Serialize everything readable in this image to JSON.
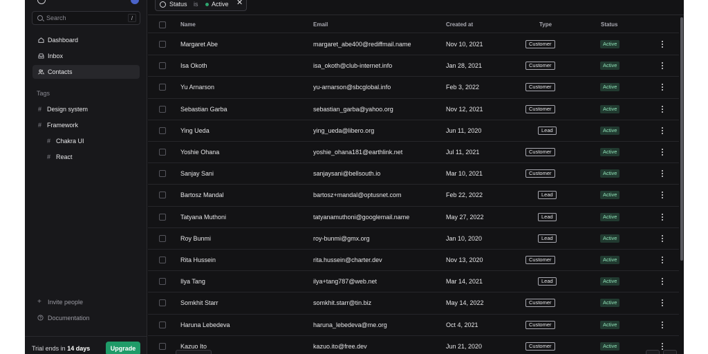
{
  "sidebar": {
    "search": {
      "placeholder": "Search",
      "shortcut": "/"
    },
    "nav": [
      {
        "label": "Dashboard",
        "icon": "home-icon",
        "active": false
      },
      {
        "label": "Inbox",
        "icon": "inbox-icon",
        "active": false
      },
      {
        "label": "Contacts",
        "icon": "users-icon",
        "active": true
      }
    ],
    "tags_heading": "Tags",
    "tags": [
      {
        "label": "Design system",
        "level": 0
      },
      {
        "label": "Framework",
        "level": 0
      },
      {
        "label": "Chakra UI",
        "level": 1
      },
      {
        "label": "React",
        "level": 1
      }
    ],
    "footer_links": [
      {
        "label": "Invite people",
        "icon": "plus-icon"
      },
      {
        "label": "Documentation",
        "icon": "help-circle-icon"
      }
    ],
    "trial": {
      "prefix": "Trial ends in ",
      "days": "14 days"
    },
    "upgrade_label": "Upgrade"
  },
  "filter": {
    "field": "Status",
    "operator": "is",
    "value": "Active"
  },
  "table": {
    "columns": {
      "name": "Name",
      "email": "Email",
      "created": "Created at",
      "type": "Type",
      "status": "Status"
    },
    "rows": [
      {
        "name": "Margaret Abe",
        "email": "margaret_abe400@rediffmail.name",
        "created": "Nov 10, 2021",
        "type": "Customer",
        "status": "Active"
      },
      {
        "name": "Isa Okoth",
        "email": "isa_okoth@club-internet.info",
        "created": "Jan 28, 2021",
        "type": "Customer",
        "status": "Active"
      },
      {
        "name": "Yu Arnarson",
        "email": "yu-arnarson@sbcglobal.info",
        "created": "Feb 3, 2022",
        "type": "Customer",
        "status": "Active"
      },
      {
        "name": "Sebastian Garba",
        "email": "sebastian_garba@yahoo.org",
        "created": "Nov 12, 2021",
        "type": "Customer",
        "status": "Active"
      },
      {
        "name": "Ying Ueda",
        "email": "ying_ueda@libero.org",
        "created": "Jun 11, 2020",
        "type": "Lead",
        "status": "Active"
      },
      {
        "name": "Yoshie Ohana",
        "email": "yoshie_ohana181@earthlink.net",
        "created": "Jul 11, 2021",
        "type": "Customer",
        "status": "Active"
      },
      {
        "name": "Sanjay Sani",
        "email": "sanjaysani@bellsouth.io",
        "created": "Mar 10, 2021",
        "type": "Customer",
        "status": "Active"
      },
      {
        "name": "Bartosz Mandal",
        "email": "bartosz+mandal@optusnet.com",
        "created": "Feb 22, 2022",
        "type": "Lead",
        "status": "Active"
      },
      {
        "name": "Tatyana Muthoni",
        "email": "tatyanamuthoni@googlemail.name",
        "created": "May 27, 2022",
        "type": "Lead",
        "status": "Active"
      },
      {
        "name": "Roy Bunmi",
        "email": "roy-bunmi@gmx.org",
        "created": "Jan 10, 2020",
        "type": "Lead",
        "status": "Active"
      },
      {
        "name": "Rita Hussein",
        "email": "rita.hussein@charter.dev",
        "created": "Nov 13, 2020",
        "type": "Customer",
        "status": "Active"
      },
      {
        "name": "Ilya Tang",
        "email": "ilya+tang787@web.net",
        "created": "Mar 14, 2021",
        "type": "Lead",
        "status": "Active"
      },
      {
        "name": "Somkhit Starr",
        "email": "somkhit.starr@tin.biz",
        "created": "May 14, 2022",
        "type": "Customer",
        "status": "Active"
      },
      {
        "name": "Haruna Lebedeva",
        "email": "haruna_lebedeva@me.org",
        "created": "Oct 4, 2021",
        "type": "Customer",
        "status": "Active"
      },
      {
        "name": "Kazuo Ito",
        "email": "kazuo.ito@free.dev",
        "created": "Jun 21, 2020",
        "type": "Customer",
        "status": "Active"
      }
    ]
  },
  "colors": {
    "accent": "#1f9b68",
    "status_bg": "#213a30",
    "status_text": "#8fe0b6",
    "background": "#131315",
    "sidebar": "#18181b"
  }
}
